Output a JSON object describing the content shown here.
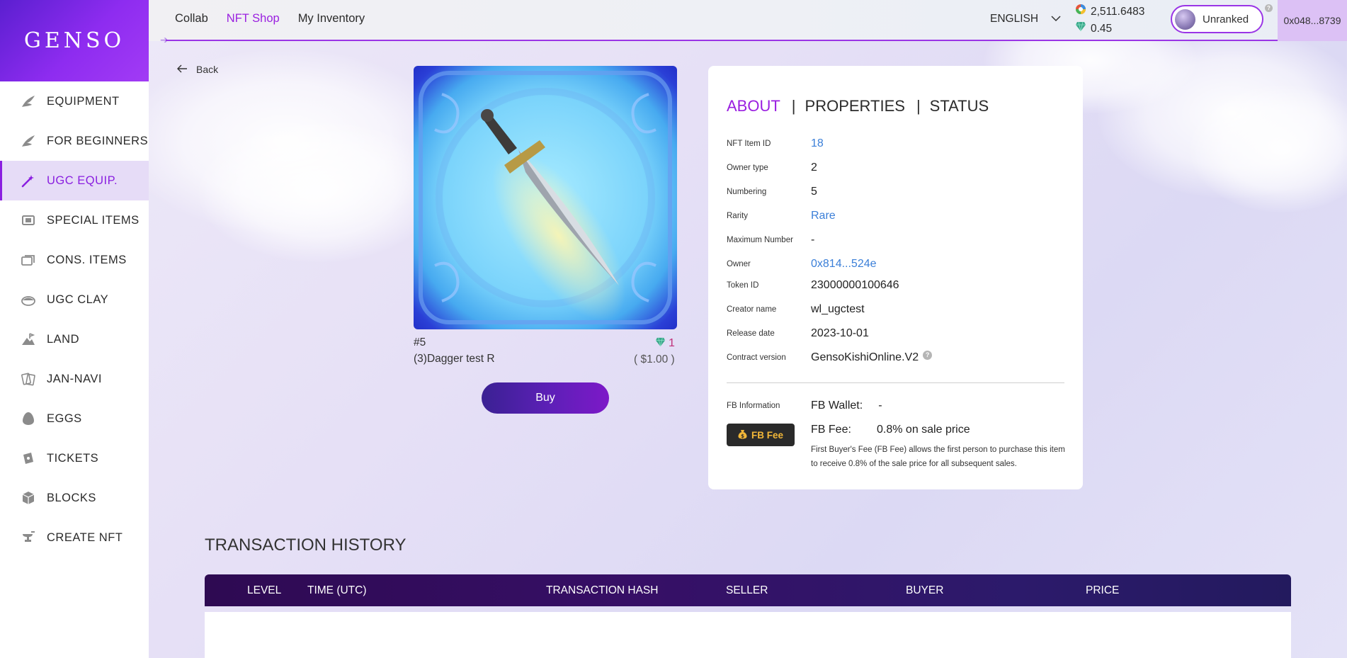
{
  "brand": {
    "logo": "GENSO"
  },
  "sidebar": {
    "items": [
      {
        "label": "EQUIPMENT",
        "icon": "wing-icon",
        "active": false
      },
      {
        "label": "FOR BEGINNERS",
        "icon": "wing-icon",
        "active": false
      },
      {
        "label": "UGC EQUIP.",
        "icon": "wand-icon",
        "active": true
      },
      {
        "label": "SPECIAL ITEMS",
        "icon": "chip-icon",
        "active": false
      },
      {
        "label": "CONS. ITEMS",
        "icon": "cards-icon",
        "active": false
      },
      {
        "label": "UGC CLAY",
        "icon": "clay-icon",
        "active": false
      },
      {
        "label": "LAND",
        "icon": "land-icon",
        "active": false
      },
      {
        "label": "JAN-NAVI",
        "icon": "jannavi-icon",
        "active": false
      },
      {
        "label": "EGGS",
        "icon": "egg-icon",
        "active": false
      },
      {
        "label": "TICKETS",
        "icon": "ticket-icon",
        "active": false
      },
      {
        "label": "BLOCKS",
        "icon": "block-icon",
        "active": false
      },
      {
        "label": "CREATE NFT",
        "icon": "anvil-icon",
        "active": false
      }
    ]
  },
  "topbar": {
    "nav": [
      {
        "label": "Collab",
        "active": false
      },
      {
        "label": "NFT Shop",
        "active": true
      },
      {
        "label": "My Inventory",
        "active": false
      }
    ],
    "language": "ENGLISH",
    "balance_primary": "2,511.6483",
    "balance_gem": "0.45",
    "rank": "Unranked",
    "wallet": "0x048...8739"
  },
  "back_label": "Back",
  "item": {
    "number": "#5",
    "name": "(3)Dagger test R",
    "price": "1",
    "price_usd": "( $1.00 )",
    "buy_label": "Buy"
  },
  "panel": {
    "tabs": [
      "ABOUT",
      "PROPERTIES",
      "STATUS"
    ],
    "sep": "|",
    "properties": [
      {
        "label": "NFT Item ID",
        "value": "18",
        "link": true
      },
      {
        "label": "Owner type",
        "value": "2",
        "link": false
      },
      {
        "label": "Numbering",
        "value": "5",
        "link": false
      },
      {
        "label": "Rarity",
        "value": "Rare",
        "link": true
      },
      {
        "label": "Maximum Number",
        "value": "-",
        "link": false
      },
      {
        "label": "Owner",
        "value": "0x814...524e",
        "link": true
      },
      {
        "label": "Token ID",
        "value": "23000000100646",
        "link": false
      },
      {
        "label": "Creator name",
        "value": "wl_ugctest",
        "link": false
      },
      {
        "label": "Release date",
        "value": "2023-10-01",
        "link": false
      },
      {
        "label": "Contract version",
        "value": "GensoKishiOnline.V2",
        "link": false
      }
    ],
    "fb": {
      "label": "FB Information",
      "wallet_label": "FB Wallet:",
      "wallet_value": "-",
      "fee_button": "FB Fee",
      "fee_label": "FB Fee:",
      "fee_value": "0.8% on sale price",
      "description": "First Buyer's Fee (FB Fee) allows the first person to purchase this item to receive 0.8% of the sale price for all subsequent sales."
    }
  },
  "transactions": {
    "title": "TRANSACTION HISTORY",
    "columns": [
      "LEVEL",
      "TIME (UTC)",
      "TRANSACTION HASH",
      "SELLER",
      "BUYER",
      "PRICE"
    ]
  },
  "colors": {
    "accent": "#9a1fe0",
    "link": "#3b7fd8",
    "price": "#c0307a",
    "table_header": "#2e0a52"
  }
}
